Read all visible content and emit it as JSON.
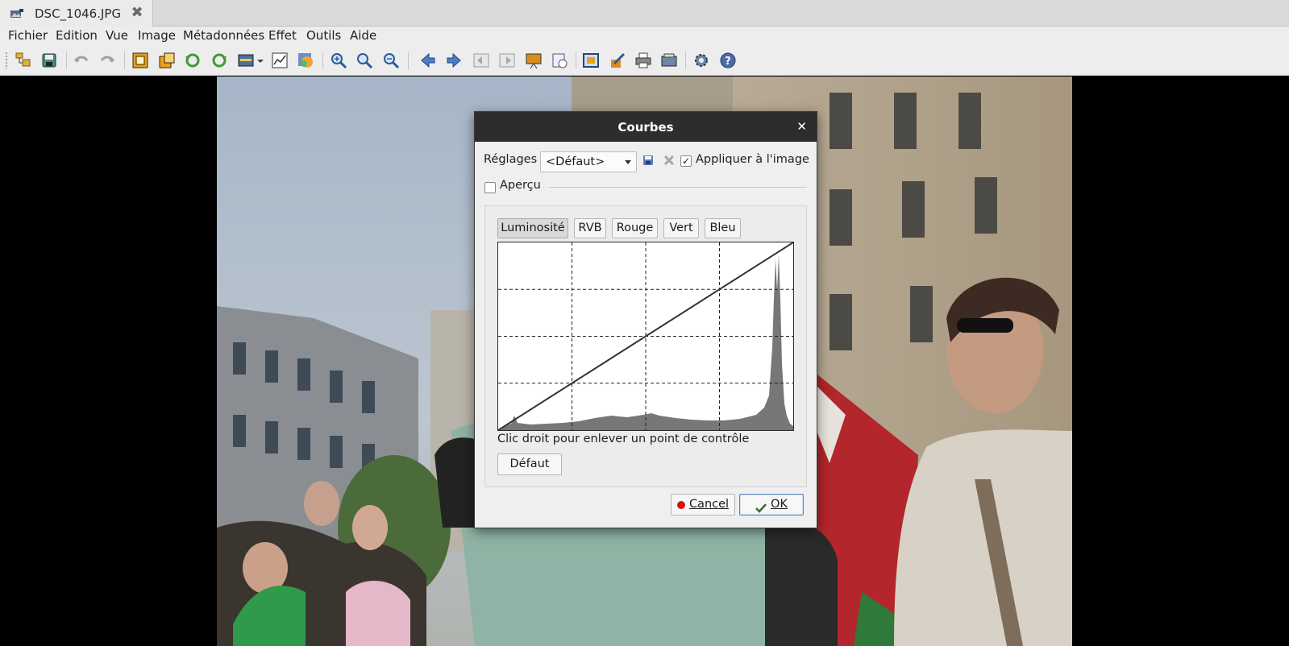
{
  "tab": {
    "title": "DSC_1046.JPG",
    "close_glyph": "✖",
    "icon": "image-viewer-icon"
  },
  "menu": [
    "Fichier",
    "Edition",
    "Vue",
    "Image",
    "Métadonnées",
    "Effet",
    "Outils",
    "Aide"
  ],
  "toolbar": {
    "icons": [
      "open-folder-icon",
      "save-icon",
      "undo-icon",
      "redo-icon",
      "crop-icon",
      "resize-icon",
      "rotate-left-icon",
      "rotate-right-icon",
      "adjust-icon",
      "histogram-icon",
      "color-icon",
      "zoom-in-icon",
      "zoom-fit-icon",
      "zoom-out-icon",
      "previous-icon",
      "next-icon",
      "first-icon",
      "last-icon",
      "slideshow-icon",
      "info-icon",
      "fullscreen-icon",
      "edit-icon",
      "print-icon",
      "scan-icon",
      "settings-icon",
      "help-icon"
    ]
  },
  "dialog": {
    "title": "Courbes",
    "close_glyph": "✕",
    "presets_label": "Réglages :",
    "presets_value": "<Défaut>",
    "apply_label": "Appliquer à l'image",
    "apply_checked": true,
    "preview_label": "Aperçu",
    "preview_checked": false,
    "channels": [
      "Luminosité",
      "RVB",
      "Rouge",
      "Vert",
      "Bleu"
    ],
    "active_channel": "Luminosité",
    "hint": "Clic droit pour enlever un point de contrôle",
    "default_button": "Défaut",
    "cancel_button": "Cancel",
    "ok_button": "OK"
  }
}
